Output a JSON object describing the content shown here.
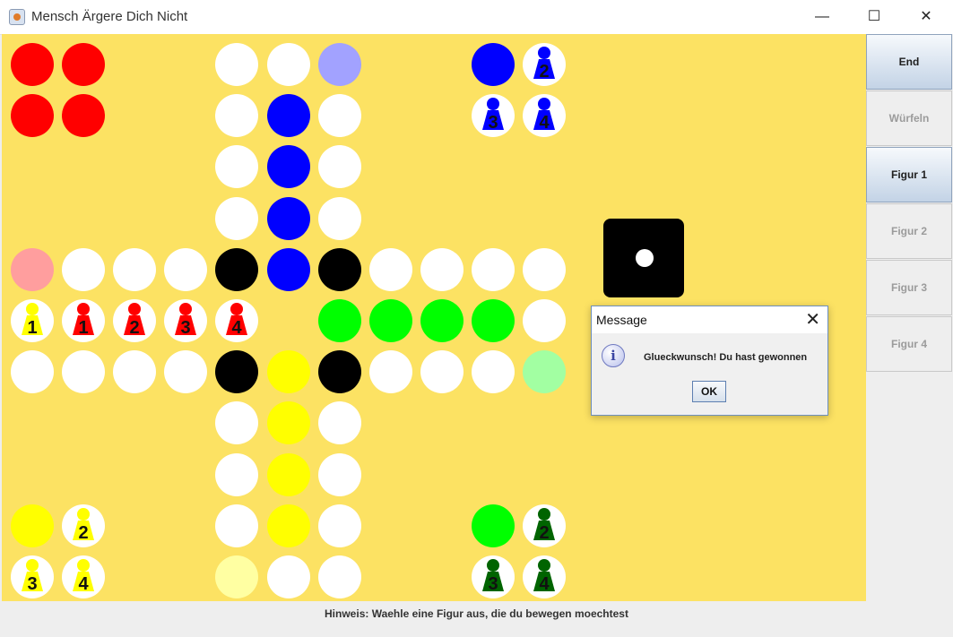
{
  "window": {
    "title": "Mensch Ärgere Dich Nicht",
    "minimize_glyph": "—",
    "maximize_glyph": "☐",
    "close_glyph": "✕",
    "app_icon": "java-app-icon"
  },
  "colors": {
    "board_background": "#fce263",
    "empty": "#ffffff",
    "red": "#ff0000",
    "blue": "#0000ff",
    "green": "#00ff00",
    "yellow": "#ffff00",
    "black": "#000000",
    "red_start": "#ff9e9e",
    "blue_start": "#a2a2ff",
    "green_start": "#a2ffa2",
    "yellow_start": "#ffffa2",
    "pawn_red": "#ff0000",
    "pawn_blue": "#0000ff",
    "pawn_yellow": "#ffff00",
    "pawn_green": "#006400"
  },
  "board": {
    "cells": [
      {
        "row": 0,
        "col": 0,
        "color": "red"
      },
      {
        "row": 0,
        "col": 1,
        "color": "red"
      },
      {
        "row": 1,
        "col": 0,
        "color": "red"
      },
      {
        "row": 1,
        "col": 1,
        "color": "red"
      },
      {
        "row": 0,
        "col": 4,
        "color": "empty"
      },
      {
        "row": 0,
        "col": 5,
        "color": "empty"
      },
      {
        "row": 0,
        "col": 6,
        "color": "blue_start"
      },
      {
        "row": 0,
        "col": 9,
        "color": "blue"
      },
      {
        "row": 0,
        "col": 10,
        "color": "empty",
        "pawn": "blue",
        "label": "2"
      },
      {
        "row": 1,
        "col": 4,
        "color": "empty"
      },
      {
        "row": 1,
        "col": 5,
        "color": "blue"
      },
      {
        "row": 1,
        "col": 6,
        "color": "empty"
      },
      {
        "row": 1,
        "col": 9,
        "color": "empty",
        "pawn": "blue",
        "label": "3"
      },
      {
        "row": 1,
        "col": 10,
        "color": "empty",
        "pawn": "blue",
        "label": "4"
      },
      {
        "row": 2,
        "col": 4,
        "color": "empty"
      },
      {
        "row": 2,
        "col": 5,
        "color": "blue"
      },
      {
        "row": 2,
        "col": 6,
        "color": "empty"
      },
      {
        "row": 3,
        "col": 4,
        "color": "empty"
      },
      {
        "row": 3,
        "col": 5,
        "color": "blue"
      },
      {
        "row": 3,
        "col": 6,
        "color": "empty"
      },
      {
        "row": 4,
        "col": 0,
        "color": "red_start"
      },
      {
        "row": 4,
        "col": 1,
        "color": "empty"
      },
      {
        "row": 4,
        "col": 2,
        "color": "empty"
      },
      {
        "row": 4,
        "col": 3,
        "color": "empty"
      },
      {
        "row": 4,
        "col": 4,
        "color": "black"
      },
      {
        "row": 4,
        "col": 5,
        "color": "blue"
      },
      {
        "row": 4,
        "col": 6,
        "color": "black"
      },
      {
        "row": 4,
        "col": 7,
        "color": "empty"
      },
      {
        "row": 4,
        "col": 8,
        "color": "empty"
      },
      {
        "row": 4,
        "col": 9,
        "color": "empty"
      },
      {
        "row": 4,
        "col": 10,
        "color": "empty"
      },
      {
        "row": 5,
        "col": 0,
        "color": "empty",
        "pawn": "yellow",
        "label": "1"
      },
      {
        "row": 5,
        "col": 1,
        "color": "empty",
        "pawn": "red",
        "label": "1"
      },
      {
        "row": 5,
        "col": 2,
        "color": "empty",
        "pawn": "red",
        "label": "2"
      },
      {
        "row": 5,
        "col": 3,
        "color": "empty",
        "pawn": "red",
        "label": "3"
      },
      {
        "row": 5,
        "col": 4,
        "color": "empty",
        "pawn": "red",
        "label": "4"
      },
      {
        "row": 5,
        "col": 6,
        "color": "green"
      },
      {
        "row": 5,
        "col": 7,
        "color": "green"
      },
      {
        "row": 5,
        "col": 8,
        "color": "green"
      },
      {
        "row": 5,
        "col": 9,
        "color": "green"
      },
      {
        "row": 5,
        "col": 10,
        "color": "empty"
      },
      {
        "row": 6,
        "col": 0,
        "color": "empty"
      },
      {
        "row": 6,
        "col": 1,
        "color": "empty"
      },
      {
        "row": 6,
        "col": 2,
        "color": "empty"
      },
      {
        "row": 6,
        "col": 3,
        "color": "empty"
      },
      {
        "row": 6,
        "col": 4,
        "color": "black"
      },
      {
        "row": 6,
        "col": 5,
        "color": "yellow"
      },
      {
        "row": 6,
        "col": 6,
        "color": "black"
      },
      {
        "row": 6,
        "col": 7,
        "color": "empty"
      },
      {
        "row": 6,
        "col": 8,
        "color": "empty"
      },
      {
        "row": 6,
        "col": 9,
        "color": "empty"
      },
      {
        "row": 6,
        "col": 10,
        "color": "green_start"
      },
      {
        "row": 7,
        "col": 4,
        "color": "empty"
      },
      {
        "row": 7,
        "col": 5,
        "color": "yellow"
      },
      {
        "row": 7,
        "col": 6,
        "color": "empty"
      },
      {
        "row": 8,
        "col": 4,
        "color": "empty"
      },
      {
        "row": 8,
        "col": 5,
        "color": "yellow"
      },
      {
        "row": 8,
        "col": 6,
        "color": "empty"
      },
      {
        "row": 9,
        "col": 0,
        "color": "yellow"
      },
      {
        "row": 9,
        "col": 1,
        "color": "empty",
        "pawn": "yellow",
        "label": "2"
      },
      {
        "row": 9,
        "col": 4,
        "color": "empty"
      },
      {
        "row": 9,
        "col": 5,
        "color": "yellow"
      },
      {
        "row": 9,
        "col": 6,
        "color": "empty"
      },
      {
        "row": 9,
        "col": 9,
        "color": "green"
      },
      {
        "row": 9,
        "col": 10,
        "color": "empty",
        "pawn": "green",
        "label": "2"
      },
      {
        "row": 10,
        "col": 0,
        "color": "empty",
        "pawn": "yellow",
        "label": "3"
      },
      {
        "row": 10,
        "col": 1,
        "color": "empty",
        "pawn": "yellow",
        "label": "4"
      },
      {
        "row": 10,
        "col": 4,
        "color": "yellow_start"
      },
      {
        "row": 10,
        "col": 5,
        "color": "empty"
      },
      {
        "row": 10,
        "col": 6,
        "color": "empty"
      },
      {
        "row": 10,
        "col": 9,
        "color": "empty",
        "pawn": "green",
        "label": "3"
      },
      {
        "row": 10,
        "col": 10,
        "color": "empty",
        "pawn": "green",
        "label": "4"
      }
    ]
  },
  "die": {
    "value": 1
  },
  "sidebar": {
    "buttons": [
      {
        "label": "End",
        "name": "end-button",
        "active": true
      },
      {
        "label": "Würfeln",
        "name": "wuerfeln-button",
        "active": false
      },
      {
        "label": "Figur 1",
        "name": "figur-1-button",
        "active": true
      },
      {
        "label": "Figur 2",
        "name": "figur-2-button",
        "active": false
      },
      {
        "label": "Figur 3",
        "name": "figur-3-button",
        "active": false
      },
      {
        "label": "Figur 4",
        "name": "figur-4-button",
        "active": false
      }
    ]
  },
  "status": {
    "hint": "Hinweis: Waehle eine Figur aus, die du bewegen moechtest"
  },
  "dialog": {
    "title": "Message",
    "message": "Glueckwunsch! Du hast gewonnen",
    "ok_label": "OK",
    "close_glyph": "✕",
    "icon_glyph": "i",
    "icon": "info-icon"
  }
}
